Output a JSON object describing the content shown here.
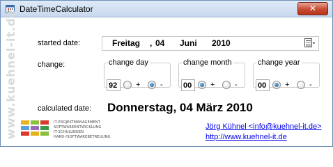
{
  "window": {
    "title": "DateTimeCalculator",
    "close_label": "✕"
  },
  "watermark": "www.kuehnel-it.de",
  "labels": {
    "started_date": "started date:",
    "change": "change:",
    "calculated_date": "calculated date:"
  },
  "started_date": {
    "weekday": "Freitag",
    "separator": ",",
    "day": "04",
    "month": "Juni",
    "year": "2010"
  },
  "change_day": {
    "legend": "change day",
    "value": "92",
    "plus": "+",
    "minus": "-",
    "selected": "minus"
  },
  "change_month": {
    "legend": "change month",
    "value": "00",
    "plus": "+",
    "minus": "-",
    "selected": "plus"
  },
  "change_year": {
    "legend": "change year",
    "value": "00",
    "plus": "+",
    "minus": "-",
    "selected": "plus"
  },
  "calculated_date": "Donnerstag, 04 März 2010",
  "links": {
    "email": "Jörg Kühnel <info@kuehnel-it.de>",
    "website": "http://www.kuehnel-it.de"
  },
  "logo": {
    "lines": [
      "IT-PROJEKTMANAGEMENT",
      "SOFTWAREENTWICKLUNG",
      "IT-SCHULUNGEN",
      "HARD-/SOFTWAREBETREUUNG"
    ],
    "colors": [
      "#e8b21e",
      "#8bbf3c",
      "#d93a2b",
      "#5aa0d6",
      "#9a6bb8",
      "#3c9a4a"
    ]
  },
  "colors": {
    "link": "#0000ee",
    "close_button": "#c74a33"
  }
}
